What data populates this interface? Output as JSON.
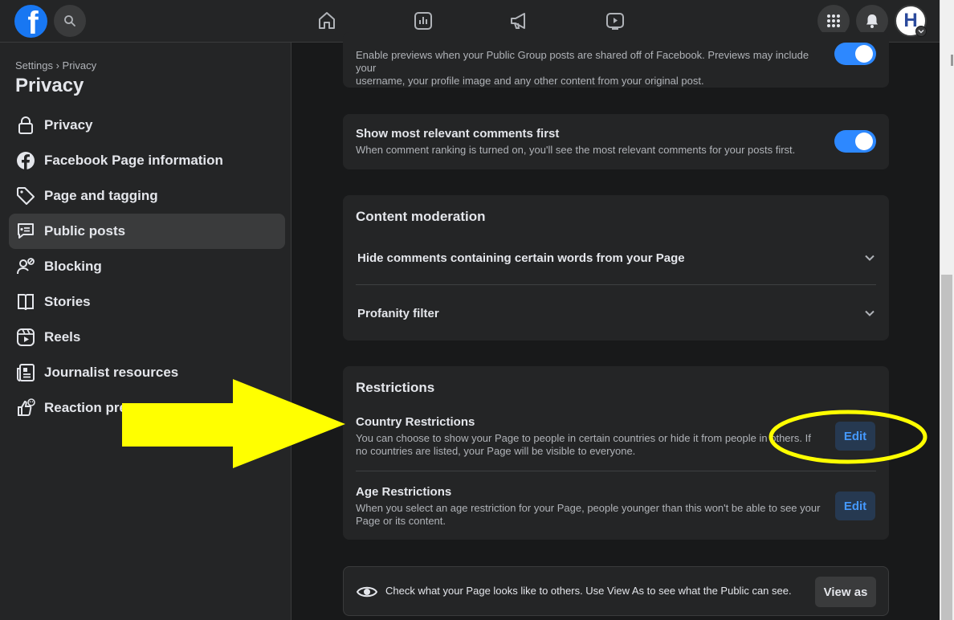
{
  "topbar": {
    "logo_letter": "f",
    "avatar_initial": "H",
    "nav_icons": [
      "home-icon",
      "insights-icon",
      "megaphone-icon",
      "video-icon"
    ],
    "right_icons": [
      "apps-grid-icon",
      "bell-icon",
      "avatar-chevron-icon"
    ]
  },
  "sidebar": {
    "breadcrumb": "Settings › Privacy",
    "title": "Privacy",
    "items": [
      {
        "label": "Privacy",
        "icon": "lock-icon"
      },
      {
        "label": "Facebook Page information",
        "icon": "facebook-icon"
      },
      {
        "label": "Page and tagging",
        "icon": "tag-icon"
      },
      {
        "label": "Public posts",
        "icon": "public-posts-icon",
        "active": true
      },
      {
        "label": "Blocking",
        "icon": "blocking-icon"
      },
      {
        "label": "Stories",
        "icon": "book-icon"
      },
      {
        "label": "Reels",
        "icon": "reels-icon"
      },
      {
        "label": "Journalist resources",
        "icon": "newspaper-icon"
      },
      {
        "label": "Reaction pre",
        "icon": "reaction-icon"
      }
    ]
  },
  "main": {
    "previews": {
      "description_line1": "Enable previews when your Public Group posts are shared off of Facebook. Previews may include your",
      "description_line2": "username, your profile image and any other content from your original post.",
      "enabled": true
    },
    "relevant_comments": {
      "title": "Show most relevant comments first",
      "description": "When comment ranking is turned on, you'll see the most relevant comments for your posts first.",
      "enabled": true
    },
    "content_moderation": {
      "title": "Content moderation",
      "items": [
        "Hide comments containing certain words from your Page",
        "Profanity filter"
      ]
    },
    "restrictions": {
      "title": "Restrictions",
      "country": {
        "title": "Country Restrictions",
        "description_line1": "You can choose to show your Page to people in certain countries or hide it from people in others. If",
        "description_line2": "no countries are listed, your Page will be visible to everyone.",
        "button": "Edit"
      },
      "age": {
        "title": "Age Restrictions",
        "description_line1": "When you select an age restriction for your Page, people younger than this won't be able to see your",
        "description_line2": "Page or its content.",
        "button": "Edit"
      }
    },
    "view_as": {
      "text": "Check what your Page looks like to others. Use View As to see what the Public can see.",
      "button": "View as",
      "icon": "eye-icon"
    }
  },
  "annotations": {
    "arrow_color": "#ffff00",
    "ellipse_color": "#ffff00"
  },
  "colors": {
    "accent": "#2d88ff",
    "background": "#18191a",
    "surface": "#242526"
  }
}
